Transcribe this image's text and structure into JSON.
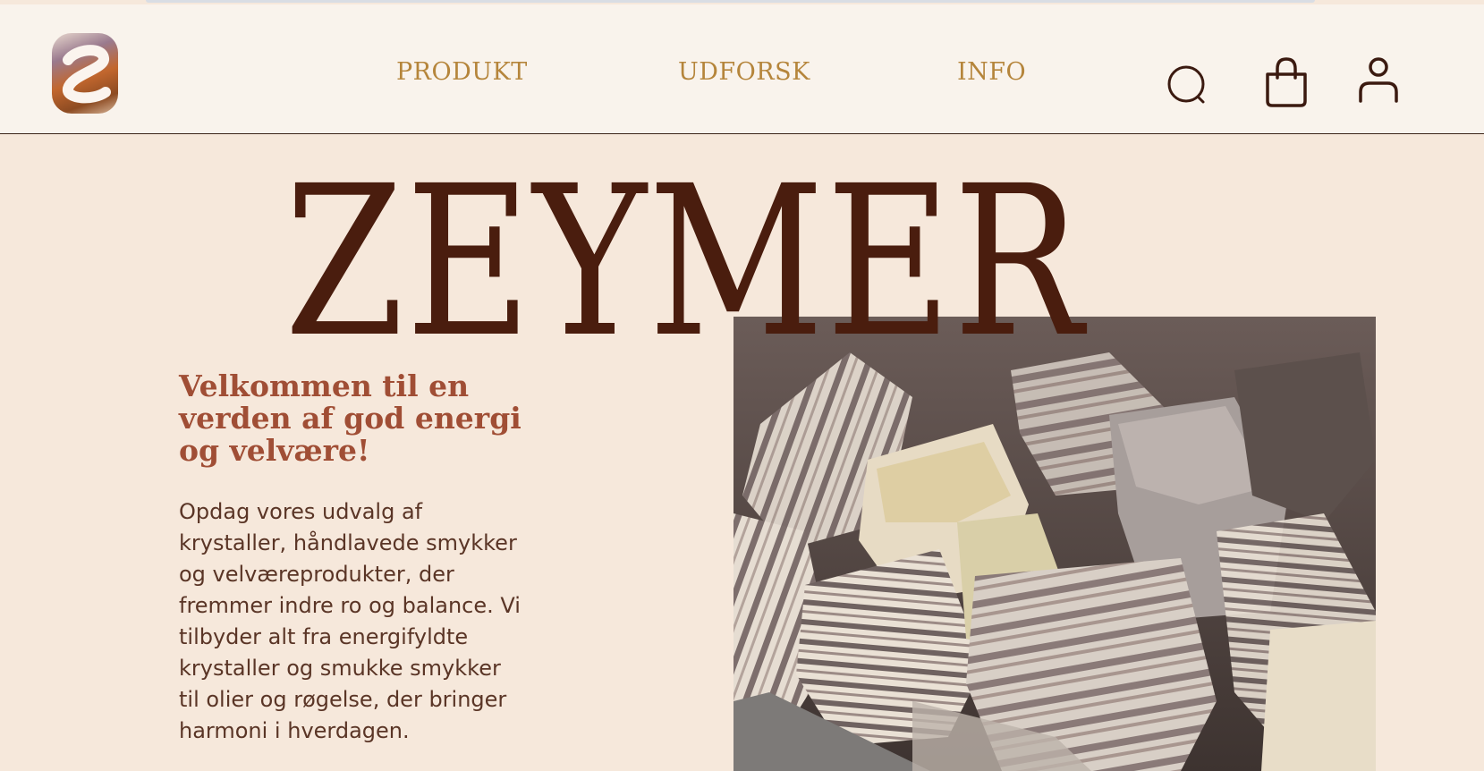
{
  "brand": {
    "logo_icon": "zeymer-z-logo-icon",
    "wordmark": "ZEYMER"
  },
  "nav": {
    "items": [
      {
        "label": "PRODUKT"
      },
      {
        "label": "UDFORSK"
      },
      {
        "label": "INFO"
      }
    ]
  },
  "header_icons": {
    "search": "search-icon",
    "cart": "shopping-bag-icon",
    "account": "user-icon"
  },
  "hero": {
    "headline": "Velkommen til en verden af god energi og velvære!",
    "body": "Opdag vores udvalg af krystaller, håndlavede smykker og velværeprodukter, der fremmer indre ro og balance. Vi tilbyder alt fra energifyldte krystaller og smukke smykker til olier og røgelse, der bringer harmoni i hverdagen."
  },
  "colors": {
    "page_background": "#f6e8db",
    "header_background": "#f9f3ec",
    "nav_text": "#b5853b",
    "wordmark": "#4a1d0e",
    "headline": "#a04e35",
    "body_text": "#5a3526",
    "icons": "#3b1a10"
  }
}
